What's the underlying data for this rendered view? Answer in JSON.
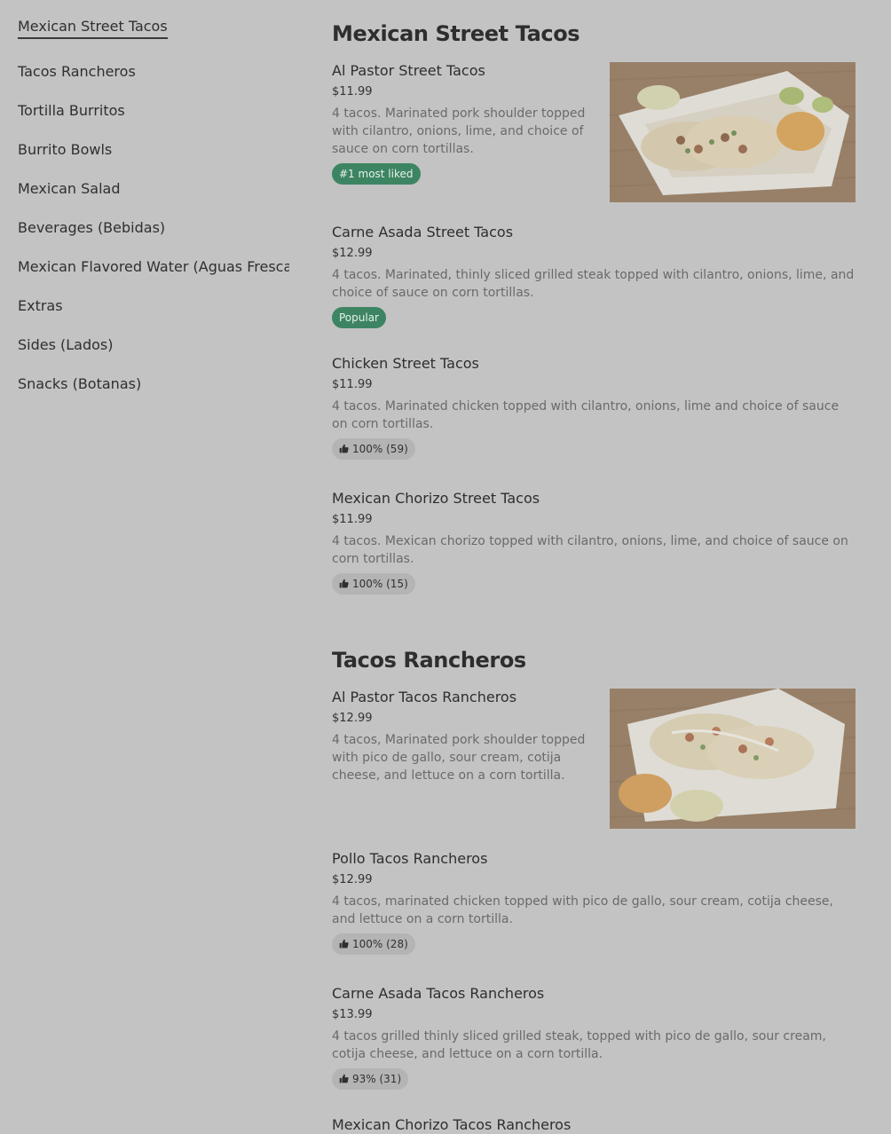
{
  "sidebar": {
    "items": [
      {
        "label": "Mexican Street Tacos"
      },
      {
        "label": "Tacos Rancheros"
      },
      {
        "label": "Tortilla Burritos"
      },
      {
        "label": "Burrito Bowls"
      },
      {
        "label": "Mexican Salad"
      },
      {
        "label": "Beverages (Bebidas)"
      },
      {
        "label": "Mexican Flavored Water (Aguas Frescas)"
      },
      {
        "label": "Extras"
      },
      {
        "label": "Sides (Lados)"
      },
      {
        "label": "Snacks (Botanas)"
      }
    ]
  },
  "sections": [
    {
      "title": "Mexican Street Tacos",
      "items": [
        {
          "name": "Al Pastor Street Tacos",
          "price": "$11.99",
          "description": "4 tacos. Marinated pork shoulder topped with cilantro, onions, lime, and choice of sauce on corn tortillas.",
          "badge": "#1 most liked",
          "image": "tacos-photo"
        },
        {
          "name": "Carne Asada Street Tacos",
          "price": "$12.99",
          "description": "4 tacos. Marinated, thinly sliced grilled steak topped with cilantro, onions, lime, and choice of sauce on corn tortillas.",
          "badge": "Popular"
        },
        {
          "name": "Chicken Street Tacos",
          "price": "$11.99",
          "description": "4 tacos. Marinated chicken topped with cilantro, onions, lime and choice of sauce on corn tortillas.",
          "rating": "100% (59)"
        },
        {
          "name": "Mexican Chorizo Street Tacos",
          "price": "$11.99",
          "description": "4 tacos. Mexican chorizo topped with cilantro, onions, lime, and choice of sauce on corn tortillas.",
          "rating": "100% (15)"
        }
      ]
    },
    {
      "title": "Tacos Rancheros",
      "items": [
        {
          "name": "Al Pastor Tacos Rancheros",
          "price": "$12.99",
          "description": "4 tacos, Marinated pork shoulder topped with pico de gallo, sour cream, cotija cheese, and lettuce on a corn tortilla.",
          "image": "tacos-rancheros-photo"
        },
        {
          "name": "Pollo Tacos Rancheros",
          "price": "$12.99",
          "description": "4 tacos, marinated chicken topped with pico de gallo, sour cream, cotija cheese, and lettuce on a corn tortilla.",
          "rating": "100% (28)"
        },
        {
          "name": "Carne Asada Tacos Rancheros",
          "price": "$13.99",
          "description": "4 tacos grilled thinly sliced grilled steak, topped with pico de gallo, sour cream, cotija cheese, and lettuce on a corn tortilla.",
          "rating": "93% (31)"
        },
        {
          "name": "Mexican Chorizo Tacos Rancheros"
        }
      ]
    }
  ],
  "colors": {
    "background": "#c3c3c3",
    "badge_green": "#3d8562"
  }
}
